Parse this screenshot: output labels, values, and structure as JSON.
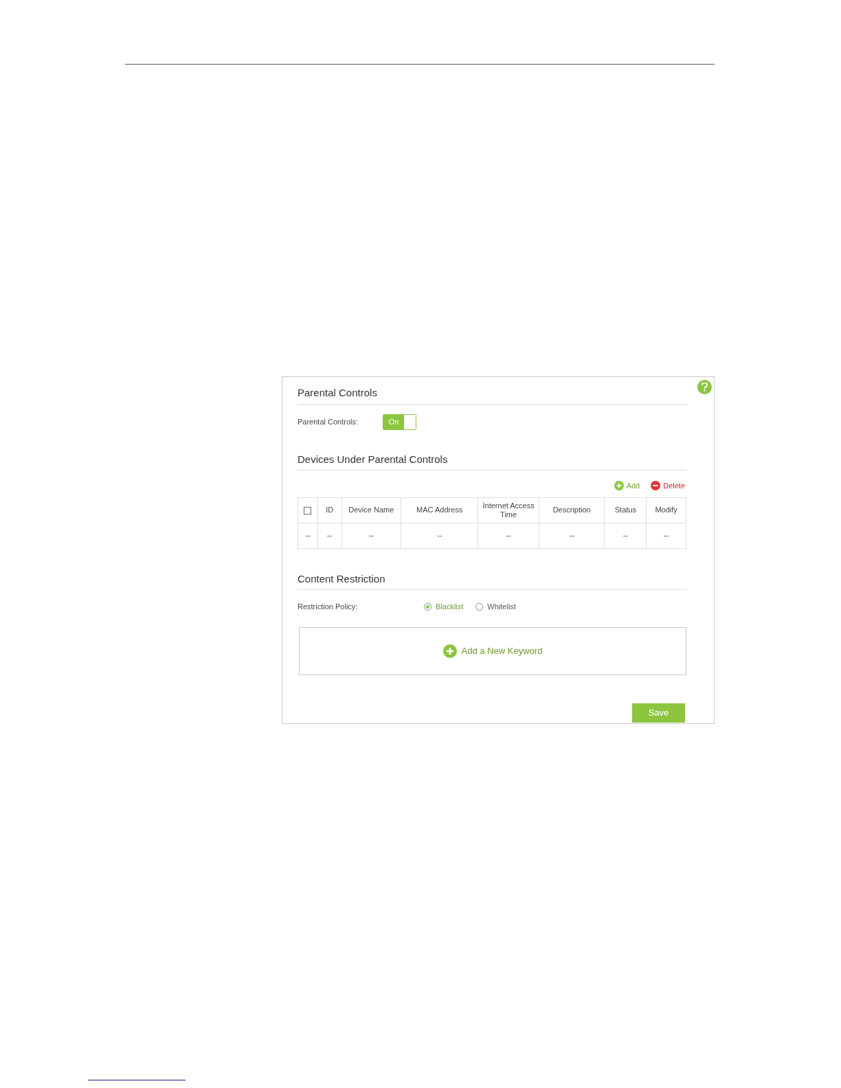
{
  "parental_controls": {
    "title": "Parental Controls",
    "label": "Parental Controls:",
    "toggle": {
      "label": "On",
      "on": true
    }
  },
  "devices": {
    "title": "Devices Under Parental Controls",
    "actions": [
      {
        "kind": "add",
        "label": "Add"
      },
      {
        "kind": "delete",
        "label": "Delete"
      }
    ],
    "table": {
      "columns": [
        {
          "kind": "checkbox",
          "checked": false
        },
        {
          "kind": "text",
          "label": "ID"
        },
        {
          "kind": "text",
          "label": "Device Name"
        },
        {
          "kind": "text",
          "label": "MAC Address"
        },
        {
          "kind": "text",
          "label": "Internet Access Time"
        },
        {
          "kind": "text",
          "label": "Description"
        },
        {
          "kind": "text",
          "label": "Status"
        },
        {
          "kind": "text",
          "label": "Modify"
        }
      ],
      "rows": [
        {
          "cells": [
            "--",
            "--",
            "--",
            "--",
            "--",
            "--",
            "--",
            "--"
          ]
        }
      ]
    }
  },
  "content_restriction": {
    "title": "Content Restriction",
    "policy_label": "Restriction Policy:",
    "options": [
      {
        "label": "Blacklist",
        "selected": true
      },
      {
        "label": "Whitelist",
        "selected": false
      }
    ],
    "add_keyword": "Add a New Keyword"
  },
  "save_button": "Save"
}
